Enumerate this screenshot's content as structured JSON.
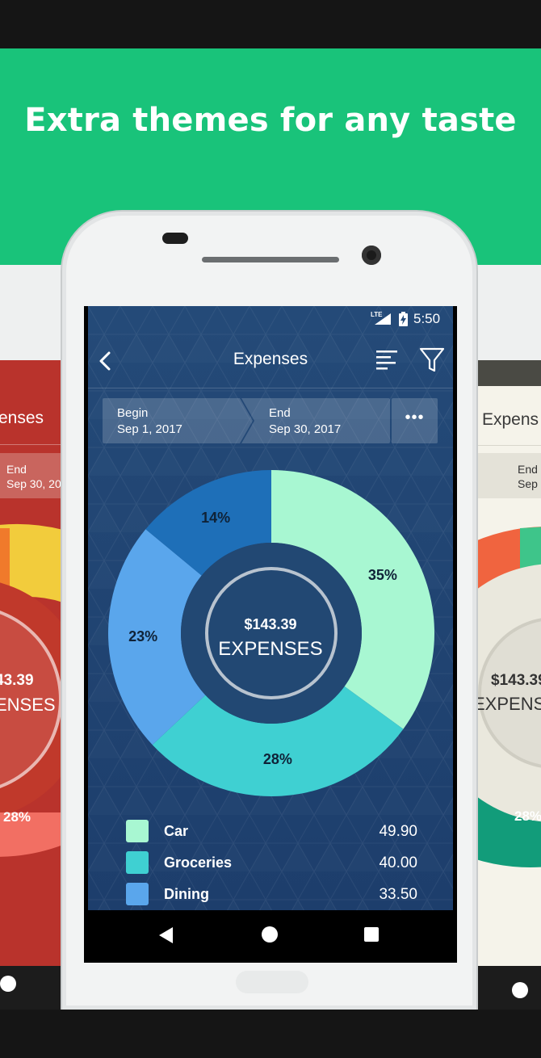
{
  "banner": {
    "headline": "Extra themes for any taste"
  },
  "colors": {
    "banner_green": "#19c37a",
    "car": "#a8f7d2",
    "groceries": "#3fd0d2",
    "dining": "#5aa6ec",
    "other": "#1e6fb8"
  },
  "left_phone": {
    "title": "enses",
    "end_label": "End",
    "end_value": "Sep 30, 20",
    "amount": "43.39",
    "label": "ENSES",
    "percent": "28%"
  },
  "right_phone": {
    "title": "Expens",
    "end_label": "End",
    "end_value": "Sep",
    "amount": "$143.39",
    "label": "EXPENS",
    "percent": "28%"
  },
  "status_bar": {
    "network": "LTE",
    "time": "5:50"
  },
  "toolbar": {
    "back_icon": "chevron-left-icon",
    "title": "Expenses",
    "sort_icon": "sort-lines-icon",
    "filter_icon": "funnel-icon"
  },
  "date_range": {
    "begin_label": "Begin",
    "begin_value": "Sep 1, 2017",
    "end_label": "End",
    "end_value": "Sep 30, 2017",
    "more_label": "•••"
  },
  "summary": {
    "amount": "$143.39",
    "label": "EXPENSES"
  },
  "chart_data": {
    "type": "pie",
    "categories": [
      "Car",
      "Groceries",
      "Dining",
      ""
    ],
    "values": [
      35,
      28,
      23,
      14
    ],
    "labels": [
      "35%",
      "28%",
      "23%",
      "14%"
    ],
    "colors": [
      "#a8f7d2",
      "#3fd0d2",
      "#5aa6ec",
      "#1e6fb8"
    ]
  },
  "legend": [
    {
      "name": "Car",
      "amount": "49.90",
      "color": "#a8f7d2"
    },
    {
      "name": "Groceries",
      "amount": "40.00",
      "color": "#3fd0d2"
    },
    {
      "name": "Dining",
      "amount": "33.50",
      "color": "#5aa6ec"
    }
  ],
  "navbar": {
    "back_icon": "triangle-back-icon",
    "home_icon": "circle-home-icon",
    "recent_icon": "square-recents-icon"
  }
}
